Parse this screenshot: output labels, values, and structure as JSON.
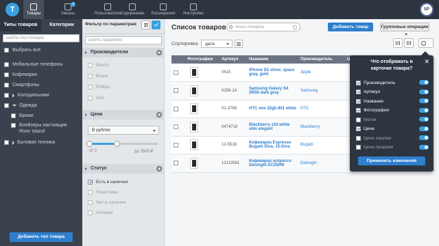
{
  "topnav": {
    "logo": "T",
    "items": [
      {
        "label": "Товары",
        "icon": "box-icon"
      },
      {
        "label": "Заказы",
        "icon": "cart-icon",
        "badge": "3"
      },
      {
        "label": "Пользователи",
        "icon": "users-icon"
      },
      {
        "label": "Содержание",
        "icon": "content-icon"
      },
      {
        "label": "Расширения",
        "icon": "puzzle-icon"
      },
      {
        "label": "Настройки",
        "icon": "gear-icon"
      }
    ],
    "avatar": "SP"
  },
  "sidebar": {
    "tabs": [
      "Типы товаров",
      "Категории"
    ],
    "search_placeholder": "найти тип товара",
    "select_all": "Выбрать всё",
    "items": [
      {
        "label": "Мобильные телефоны"
      },
      {
        "label": "Кофеварки"
      },
      {
        "label": "Смартфоны"
      },
      {
        "label": "Холодильники"
      },
      {
        "label": "Одежда"
      },
      {
        "label": "Брюки"
      },
      {
        "label": "Блейзеры настоящие River Island"
      },
      {
        "label": "Бытовая техника"
      }
    ],
    "add_button": "Добавить тип товара"
  },
  "filter": {
    "title": "Фильтр по параметрам",
    "search_placeholder": "найти параметр",
    "sections": {
      "manufacturer": {
        "title": "Производители",
        "options": [
          "Bosch",
          "Braun",
          "Phillips",
          "Dell"
        ]
      },
      "price": {
        "title": "Цена",
        "currency": "В рублях",
        "from": "от 0",
        "to": "до 3505 ₽",
        "range_min": 0.0,
        "range_max": 0.4
      },
      "status": {
        "title": "Статус",
        "options": [
          "Есть в наличии",
          "Неактивен",
          "Нет в наличии",
          "Активен"
        ]
      }
    }
  },
  "main": {
    "title": "Список товаров",
    "search_placeholder": "поиск товаров",
    "add_button": "Добавить товар",
    "group_ops": "Групповые операции",
    "sort_label": "Сортировка",
    "sort_value": "дата",
    "columns": [
      "",
      "Фотографии",
      "Артикул",
      "Название",
      "Производитель",
      "Ц"
    ],
    "rows": [
      {
        "sku": "0415",
        "name": "iPhone 5S silver, space gray, gold",
        "mfr": "Apple"
      },
      {
        "sku": "0256-1A",
        "name": "Samsung Galaxy S4 i9550 dark gray",
        "mfr": "Samsung"
      },
      {
        "sku": "01-3789",
        "name": "HTC one 32gb 801 white",
        "mfr": "HTC"
      },
      {
        "sku": "0474716",
        "name": "Blackberry z10 white slim elegant",
        "mfr": "Blackberry"
      },
      {
        "sku": "12-5518",
        "name": "Кофеварка Espresso Bugatti Diva, 15-Diva",
        "mfr": "Bugatti"
      },
      {
        "sku": "12113581",
        "name": "Кофеварка эспрессо Delonghi EC250W",
        "mfr": "Delonghi"
      }
    ]
  },
  "popup": {
    "title": "Что отображать в карточке товара?",
    "options": [
      {
        "label": "Производитель",
        "checked": true
      },
      {
        "label": "Артикул",
        "checked": true
      },
      {
        "label": "Название",
        "checked": true
      },
      {
        "label": "Фотография",
        "checked": true
      },
      {
        "label": "Метки",
        "checked": false
      },
      {
        "label": "Цена",
        "checked": true
      },
      {
        "label": "Цена закупки",
        "checked": false
      },
      {
        "label": "Цена продажи",
        "checked": false
      }
    ],
    "apply": "Применить изменения"
  }
}
